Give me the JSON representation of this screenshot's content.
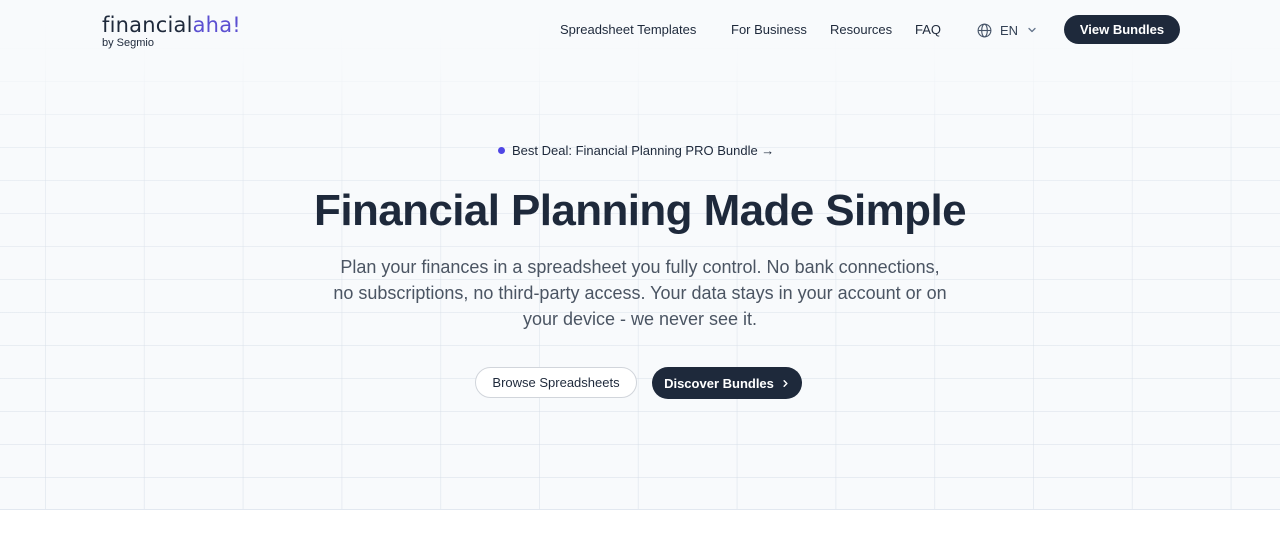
{
  "header": {
    "logo": {
      "main": "financial",
      "accent": "aha!",
      "sub": "by Segmio"
    },
    "nav": [
      {
        "label": "Spreadsheet Templates"
      },
      {
        "label": "For Business"
      },
      {
        "label": "Resources"
      },
      {
        "label": "FAQ"
      }
    ],
    "language": {
      "icon": "globe-icon",
      "value": "EN",
      "dropdown_icon": "chevron-down-icon"
    },
    "cta_label": "View Bundles"
  },
  "hero": {
    "deal_label": "Best Deal: Financial Planning PRO Bundle →",
    "title": "Financial Planning Made Simple",
    "description": "Plan your finances in a spreadsheet you fully control. No bank connections, no subscriptions, no third-party access. Your data stays in your account or on your device - we never see it.",
    "secondary_button": "Browse Spreadsheets",
    "primary_button": "Discover Bundles",
    "primary_button_icon": "chevron-right-icon"
  },
  "colors": {
    "brand_dark": "#1e293b",
    "brand_accent": "#5b4fd1",
    "deal_dot": "#4f46e5",
    "hero_background": "#f8fafc"
  }
}
